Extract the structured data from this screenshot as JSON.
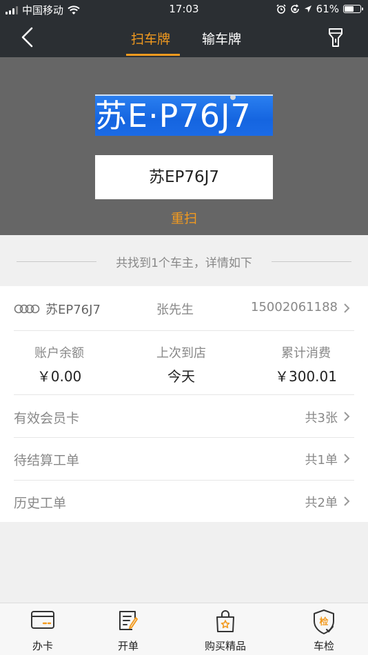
{
  "status_bar": {
    "carrier": "中国移动",
    "time": "17:03",
    "battery": "61%"
  },
  "nav": {
    "tabs": [
      {
        "label": "扫车牌",
        "active": true
      },
      {
        "label": "输车牌",
        "active": false
      }
    ],
    "accent_color": "#f29a1f",
    "back_icon": "chevron-left-icon",
    "flash_icon": "flashlight-icon"
  },
  "scan": {
    "plate_image_text": "苏E·P76J7",
    "recognized_plate": "苏EP76J7",
    "rescan_label": "重扫"
  },
  "result": {
    "summary": "共找到1个车主，详情如下",
    "owner": {
      "brand_icon": "audi-rings-icon",
      "plate": "苏EP76J7",
      "name": "张先生",
      "phone": "15002061188"
    },
    "stats": [
      {
        "label": "账户余额",
        "value": "￥0.00"
      },
      {
        "label": "上次到店",
        "value": "今天"
      },
      {
        "label": "累计消费",
        "value": "￥300.01"
      }
    ],
    "rows": [
      {
        "label": "有效会员卡",
        "count": "共3张"
      },
      {
        "label": "待结算工单",
        "count": "共1单"
      },
      {
        "label": "历史工单",
        "count": "共2单"
      }
    ]
  },
  "tabbar": [
    {
      "label": "办卡",
      "icon": "card-icon"
    },
    {
      "label": "开单",
      "icon": "order-edit-icon"
    },
    {
      "label": "购买精品",
      "icon": "shopping-bag-icon"
    },
    {
      "label": "车检",
      "icon": "inspection-shield-icon"
    }
  ]
}
